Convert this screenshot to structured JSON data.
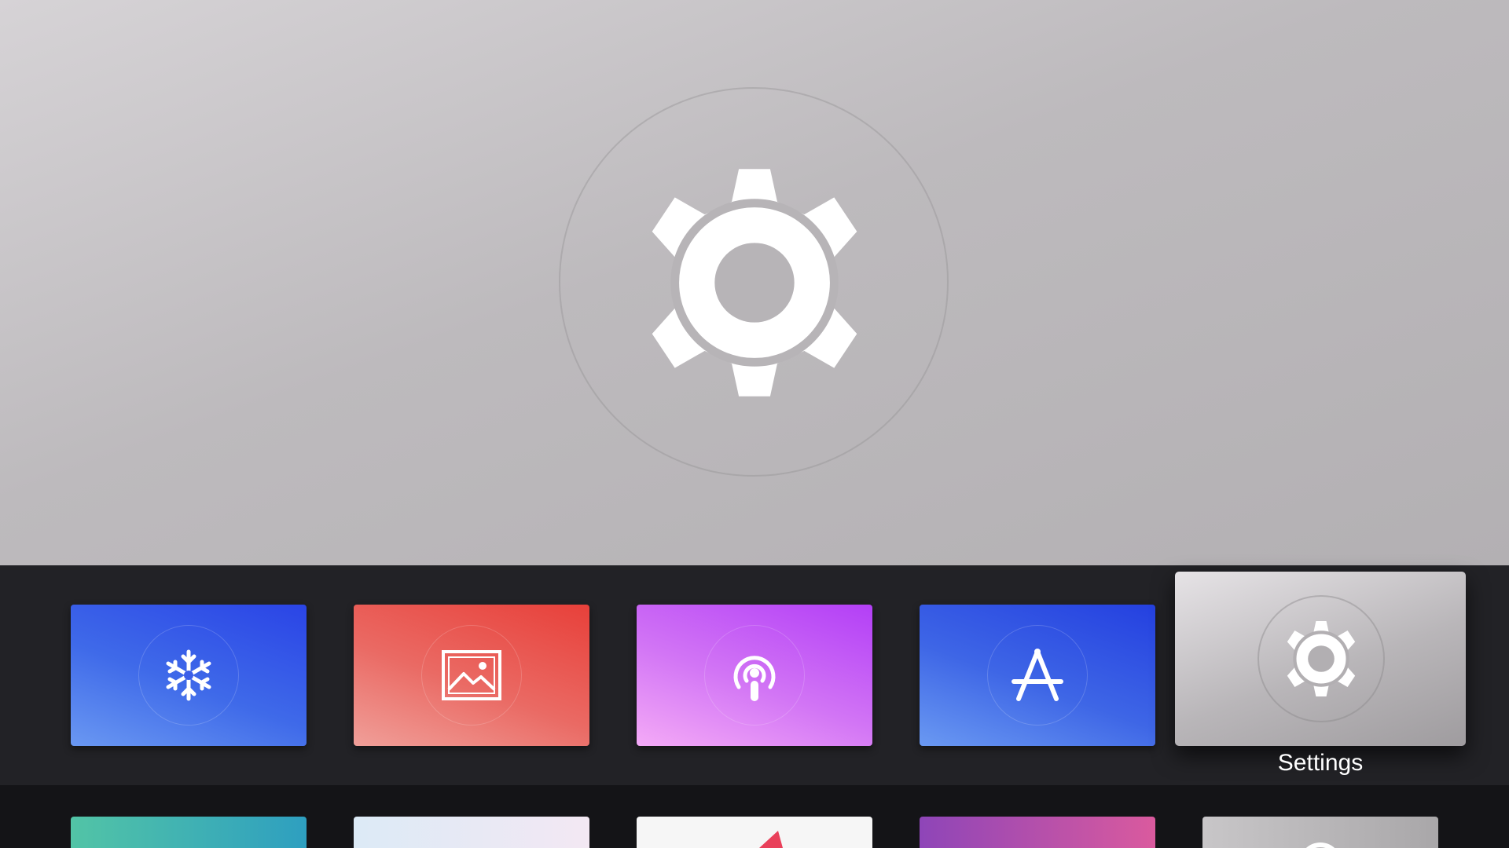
{
  "top_shelf": {
    "featured_app_icon": "gear-icon",
    "background_color": "#c4c1c4"
  },
  "apps": [
    {
      "icon": "snowflake-icon",
      "gradient": [
        "#2a44e6",
        "#5f8ef0"
      ],
      "focused": false
    },
    {
      "icon": "photos-icon",
      "gradient": [
        "#e8493c",
        "#ee9a93"
      ],
      "focused": false
    },
    {
      "icon": "podcasts-icon",
      "gradient": [
        "#b344f6",
        "#f2a4f6"
      ],
      "focused": false
    },
    {
      "icon": "app-store-icon",
      "gradient": [
        "#2640e0",
        "#6594f0"
      ],
      "focused": false
    },
    {
      "icon": "gear-icon",
      "gradient": [
        "#e6e3e6",
        "#9f9c9f"
      ],
      "focused": true,
      "label": "Settings"
    }
  ],
  "second_row_apps": [
    {
      "gradient": [
        "#52c4a6",
        "#2e9fc0"
      ]
    },
    {
      "gradient": [
        "#dceaf6",
        "#f3e8f3"
      ]
    },
    {
      "gradient": [
        "#f4f4f4",
        "#ffffff"
      ]
    },
    {
      "gradient": [
        "#8e45b8",
        "#da5a9e"
      ]
    },
    {
      "gradient": [
        "#c8c6c8",
        "#a9a7a9"
      ]
    }
  ]
}
